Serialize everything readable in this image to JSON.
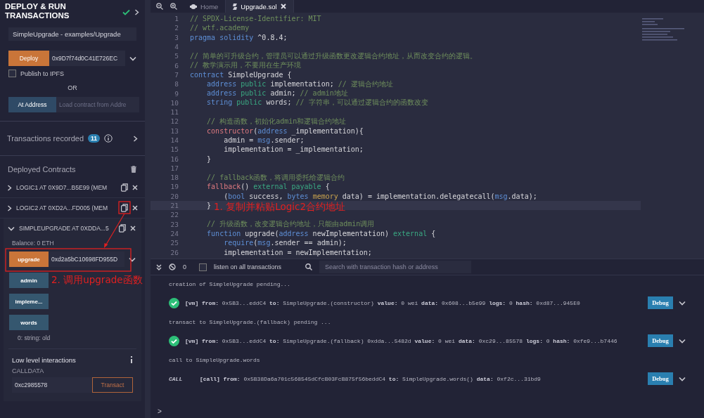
{
  "panel": {
    "title": "DEPLOY & RUN TRANSACTIONS",
    "contract_select": "SimpleUpgrade - examples/Upgrade",
    "deploy_button": "Deploy",
    "deploy_value": "0x9D7f74d0C41E726EC",
    "publish": {
      "label": "Publish to IPFS",
      "checked": false
    },
    "or_label": "OR",
    "at_address_button": "At Address",
    "at_address_placeholder": "Load contract from Addre",
    "transactions_label": "Transactions recorded",
    "transactions_count": "11",
    "deployed_label": "Deployed Contracts",
    "contracts": [
      {
        "title": "LOGIC1 AT 0X9D7...B5E99 (MEM",
        "expanded": false
      },
      {
        "title": "LOGIC2 AT 0XD2A...FD005 (MEM",
        "expanded": false
      },
      {
        "title": "SIMPLEUPGRADE AT 0XDDA...5",
        "expanded": true
      }
    ],
    "balance": "Balance: 0 ETH",
    "functions": [
      {
        "label": "upgrade",
        "kind": "transact",
        "value": "0xd2a5bC10698FD955D"
      },
      {
        "label": "admin",
        "kind": "call"
      },
      {
        "label": "impleme...",
        "kind": "call"
      },
      {
        "label": "words",
        "kind": "call"
      }
    ],
    "result": "0: string: old",
    "low_level_label": "Low level interactions",
    "calldata_label": "CALLDATA",
    "calldata_value": "0xc2985578",
    "transact_button": "Transact"
  },
  "editor": {
    "tabs": [
      {
        "label": "Home",
        "selected": false
      },
      {
        "label": "Upgrade.sol",
        "selected": true
      }
    ],
    "lines": [
      {
        "number": "1",
        "highlighted": false,
        "tokens": [
          {
            "kind": "comment",
            "text": "// SPDX-License-Identifier: MIT"
          }
        ]
      },
      {
        "number": "2",
        "highlighted": false,
        "tokens": [
          {
            "kind": "comment",
            "text": "// wtf.academy"
          }
        ]
      },
      {
        "number": "3",
        "highlighted": false,
        "tokens": [
          {
            "kind": "keyword",
            "text": "pragma "
          },
          {
            "kind": "keyword",
            "text": "solidity"
          },
          {
            "kind": "plain",
            "text": " ^0.8.4;"
          }
        ]
      },
      {
        "number": "4",
        "highlighted": false
      },
      {
        "number": "5",
        "highlighted": false,
        "tokens": [
          {
            "kind": "comment",
            "text": "// 简单的可升级合约，管理员可以通过升级函数更改逻辑合约地址，从而改变合约的逻辑。"
          }
        ]
      },
      {
        "number": "6",
        "highlighted": false,
        "tokens": [
          {
            "kind": "comment",
            "text": "// 教学演示用，不要用在生产环境"
          }
        ]
      },
      {
        "number": "7",
        "highlighted": false,
        "tokens": [
          {
            "kind": "keyword",
            "text": "contract"
          },
          {
            "kind": "plain",
            "text": " SimpleUpgrade {"
          }
        ]
      },
      {
        "number": "8",
        "highlighted": false,
        "tokens": [
          {
            "kind": "keyword",
            "text": "    address "
          },
          {
            "kind": "modifier",
            "text": "public"
          },
          {
            "kind": "plain",
            "text": " implementation; "
          },
          {
            "kind": "comment",
            "text": "// 逻辑合约地址"
          }
        ]
      },
      {
        "number": "9",
        "highlighted": false,
        "tokens": [
          {
            "kind": "keyword",
            "text": "    address "
          },
          {
            "kind": "modifier",
            "text": "public"
          },
          {
            "kind": "plain",
            "text": " admin; "
          },
          {
            "kind": "comment",
            "text": "// admin地址"
          }
        ]
      },
      {
        "number": "10",
        "highlighted": false,
        "tokens": [
          {
            "kind": "keyword",
            "text": "    string "
          },
          {
            "kind": "modifier",
            "text": "public"
          },
          {
            "kind": "plain",
            "text": " words; "
          },
          {
            "kind": "comment",
            "text": "// 字符串，可以通过逻辑合约的函数改变"
          }
        ]
      },
      {
        "number": "11",
        "highlighted": false
      },
      {
        "number": "12",
        "highlighted": false,
        "tokens": [
          {
            "kind": "comment",
            "text": "    // 构造函数，初始化admin和逻辑合约地址"
          }
        ]
      },
      {
        "number": "13",
        "highlighted": false,
        "tokens": [
          {
            "kind": "builtin",
            "text": "    constructor"
          },
          {
            "kind": "plain",
            "text": "("
          },
          {
            "kind": "keyword",
            "text": "address"
          },
          {
            "kind": "plain",
            "text": " _implementation){"
          }
        ]
      },
      {
        "number": "14",
        "highlighted": false,
        "tokens": [
          {
            "kind": "plain",
            "text": "        admin = "
          },
          {
            "kind": "keyword",
            "text": "msg"
          },
          {
            "kind": "plain",
            "text": ".sender;"
          }
        ]
      },
      {
        "number": "15",
        "highlighted": false,
        "tokens": [
          {
            "kind": "plain",
            "text": "        implementation = _implementation;"
          }
        ]
      },
      {
        "number": "16",
        "highlighted": false,
        "tokens": [
          {
            "kind": "plain",
            "text": "    }"
          }
        ]
      },
      {
        "number": "17",
        "highlighted": false
      },
      {
        "number": "18",
        "highlighted": false,
        "tokens": [
          {
            "kind": "comment",
            "text": "    // fallback函数，将调用委托给逻辑合约"
          }
        ]
      },
      {
        "number": "19",
        "highlighted": false,
        "tokens": [
          {
            "kind": "builtin",
            "text": "    fallback"
          },
          {
            "kind": "plain",
            "text": "() "
          },
          {
            "kind": "modifier",
            "text": "external "
          },
          {
            "kind": "modifier",
            "text": "payable"
          },
          {
            "kind": "plain",
            "text": " {"
          }
        ]
      },
      {
        "number": "20",
        "highlighted": false,
        "tokens": [
          {
            "kind": "plain",
            "text": "        ("
          },
          {
            "kind": "keyword",
            "text": "bool"
          },
          {
            "kind": "plain",
            "text": " success, "
          },
          {
            "kind": "keyword",
            "text": "bytes "
          },
          {
            "kind": "storage",
            "text": "memory"
          },
          {
            "kind": "plain",
            "text": " data) = implementation.delegatecall("
          },
          {
            "kind": "keyword",
            "text": "msg"
          },
          {
            "kind": "plain",
            "text": ".data);"
          }
        ]
      },
      {
        "number": "21",
        "highlighted": true,
        "tokens": [
          {
            "kind": "plain",
            "text": "    }"
          }
        ]
      },
      {
        "number": "22",
        "highlighted": false
      },
      {
        "number": "23",
        "highlighted": false,
        "tokens": [
          {
            "kind": "comment",
            "text": "    // 升级函数，改变逻辑合约地址，只能由admin调用"
          }
        ]
      },
      {
        "number": "24",
        "highlighted": false,
        "tokens": [
          {
            "kind": "keyword",
            "text": "    function"
          },
          {
            "kind": "plain",
            "text": " upgrade("
          },
          {
            "kind": "keyword",
            "text": "address"
          },
          {
            "kind": "plain",
            "text": " newImplementation) "
          },
          {
            "kind": "modifier",
            "text": "external"
          },
          {
            "kind": "plain",
            "text": " {"
          }
        ]
      },
      {
        "number": "25",
        "highlighted": false,
        "tokens": [
          {
            "kind": "keyword",
            "text": "        require"
          },
          {
            "kind": "plain",
            "text": "("
          },
          {
            "kind": "keyword",
            "text": "msg"
          },
          {
            "kind": "plain",
            "text": ".sender == admin);"
          }
        ]
      },
      {
        "number": "26",
        "highlighted": false,
        "tokens": [
          {
            "kind": "plain",
            "text": "        implementation = newImplementation;"
          }
        ]
      }
    ]
  },
  "console": {
    "count": "0",
    "listen": {
      "label": "listen on all transactions",
      "checked": false
    },
    "search_placeholder": "Search with transaction hash or address",
    "entries": [
      {
        "kind": "log",
        "text": "creation of SimpleUpgrade pending..."
      },
      {
        "kind": "tx",
        "text": "**[vm]  from:** 0x5B3...eddC4 **to:** SimpleUpgrade.(constructor) **value:** 0 wei **data:** 0x608...b5e99 **logs:** 0 **hash:** 0xd87...945E0",
        "button": "Debug"
      },
      {
        "kind": "log",
        "text": "transact to SimpleUpgrade.(fallback) pending ..."
      },
      {
        "kind": "tx",
        "text": "**[vm]  from:** 0x5B3...eddC4 **to:** SimpleUpgrade.(fallback) 0xdda...5482d **value:** 0 wei **data:** 0xc29...85578 **logs:** 0 **hash:** 0xfe9...b7446",
        "button": "Debug"
      },
      {
        "kind": "log",
        "text": "call to SimpleUpgrade.words"
      },
      {
        "kind": "call",
        "label": "CALL",
        "text": "**[call]  from:** 0x5B38Da6a701c568545dCfcB03FcB875f56beddC4 **to:** SimpleUpgrade.words() **data:** 0xf2c...31bd9",
        "button": "Debug"
      }
    ],
    "prompt": ">"
  },
  "annotations": [
    {
      "text": "1. 复制并粘贴Logic2合约地址"
    },
    {
      "text": "2. 调用upgrade函数"
    }
  ]
}
